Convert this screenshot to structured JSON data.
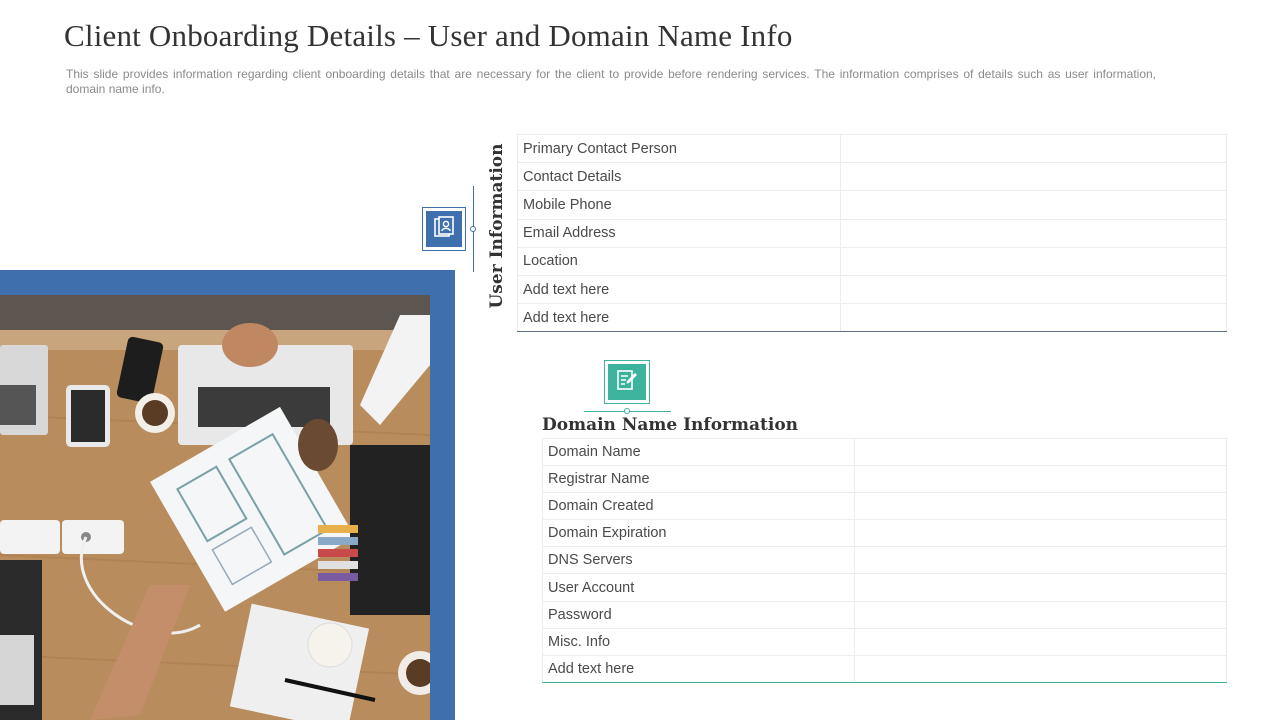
{
  "header": {
    "title": "Client Onboarding Details – User and Domain Name Info",
    "subtitle": "This slide provides information regarding client onboarding details that are necessary for the client to provide before rendering services. The information comprises of details such as user information, domain name info."
  },
  "user_section": {
    "title": "User Information",
    "icon": "user-card-icon",
    "accent_color": "#3f6fad",
    "rows": [
      {
        "label": "Primary Contact Person",
        "value": ""
      },
      {
        "label": "Contact Details",
        "value": ""
      },
      {
        "label": "Mobile  Phone",
        "value": ""
      },
      {
        "label": "Email Address",
        "value": ""
      },
      {
        "label": "Location",
        "value": ""
      },
      {
        "label": "Add text here",
        "value": ""
      },
      {
        "label": "Add text here",
        "value": ""
      }
    ]
  },
  "domain_section": {
    "title": "Domain Name Information",
    "icon": "document-edit-icon",
    "accent_color": "#3db39e",
    "rows": [
      {
        "label": "Domain Name",
        "value": ""
      },
      {
        "label": "Registrar Name",
        "value": ""
      },
      {
        "label": "Domain Created",
        "value": ""
      },
      {
        "label": "Domain Expiration",
        "value": ""
      },
      {
        "label": "DNS Servers",
        "value": ""
      },
      {
        "label": "User Account",
        "value": ""
      },
      {
        "label": "Password",
        "value": ""
      },
      {
        "label": "Misc. Info",
        "value": ""
      },
      {
        "label": "Add text here",
        "value": ""
      }
    ]
  }
}
